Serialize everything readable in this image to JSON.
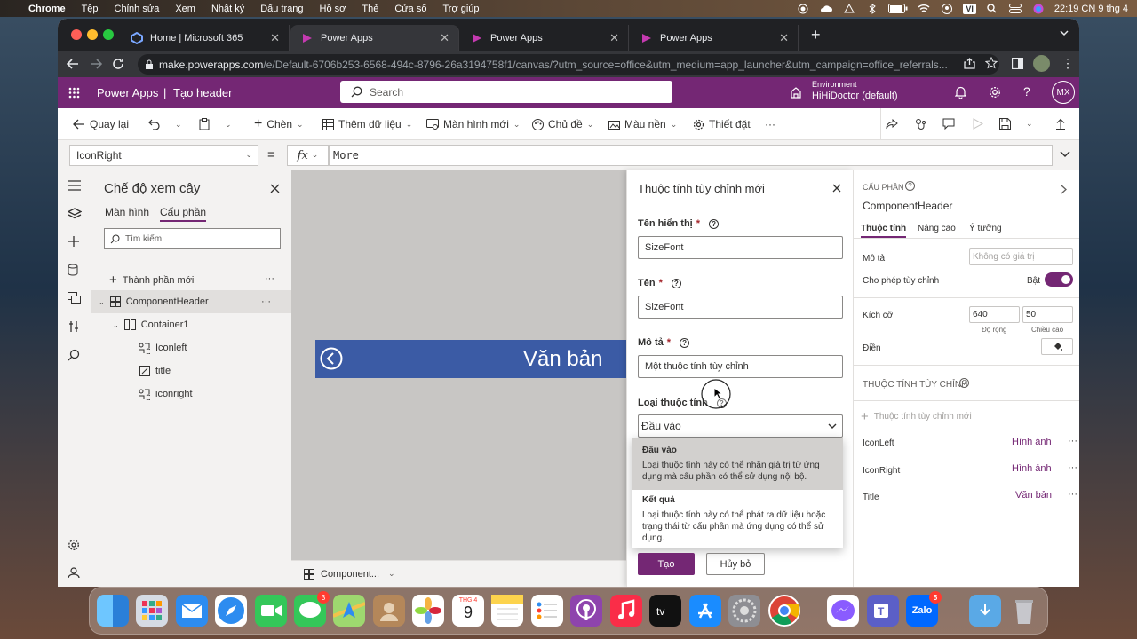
{
  "macmenu": {
    "apple": "",
    "app": "Chrome",
    "items": [
      "Tệp",
      "Chỉnh sửa",
      "Xem",
      "Nhật ký",
      "Dấu trang",
      "Hồ sơ",
      "Thẻ",
      "Cửa sổ",
      "Trợ giúp"
    ],
    "lang": "VI",
    "clock": "22:19 CN 9 thg 4"
  },
  "browser": {
    "tabs": [
      {
        "title": "Home | Microsoft 365"
      },
      {
        "title": "Power Apps"
      },
      {
        "title": "Power Apps"
      },
      {
        "title": "Power Apps"
      }
    ],
    "new_tab": "+",
    "url_host": "make.powerapps.com",
    "url_path": "/e/Default-6706b253-6568-494c-8796-26a3194758f1/canvas/?utm_source=office&utm_medium=app_launcher&utm_campaign=office_referrals..."
  },
  "header": {
    "app": "Power Apps",
    "sep": "|",
    "page": "Tạo header",
    "search_placeholder": "Search",
    "env_label": "Environment",
    "env_name": "HiHiDoctor (default)",
    "avatar": "MX"
  },
  "cmdbar": {
    "back": "Quay lại",
    "insert": "Chèn",
    "add_data": "Thêm dữ liệu",
    "new_screen": "Màn hình mới",
    "theme": "Chủ đề",
    "background": "Màu nền",
    "settings": "Thiết đặt",
    "more": "···"
  },
  "formula": {
    "property": "IconRight",
    "equals": "=",
    "fx": "fx",
    "value": "More"
  },
  "tree": {
    "title": "Chế độ xem cây",
    "tab_screens": "Màn hình",
    "tab_components": "Cấu phần",
    "search_placeholder": "Tìm kiếm",
    "new_component": "Thành phần mới",
    "items": [
      {
        "label": "ComponentHeader"
      },
      {
        "label": "Container1"
      },
      {
        "label": "Iconleft"
      },
      {
        "label": "title"
      },
      {
        "label": "iconright"
      }
    ]
  },
  "canvas": {
    "banner_text": "Văn bản",
    "status_component": "Component..."
  },
  "dialog": {
    "title": "Thuộc tính tùy chỉnh mới",
    "display_name_label": "Tên hiển thị",
    "display_name_value": "SizeFont",
    "name_label": "Tên",
    "name_value": "SizeFont",
    "desc_label": "Mô tả",
    "desc_value": "Một thuộc tính tùy chỉnh",
    "type_label": "Loại thuộc tính",
    "type_value": "Đầu vào",
    "options": [
      {
        "title": "Đầu vào",
        "desc": "Loại thuộc tính này có thể nhận giá trị từ ứng dụng mà cấu phần có thể sử dụng nội bộ."
      },
      {
        "title": "Kết quả",
        "desc": "Loại thuộc tính này có thể phát ra dữ liệu hoặc trạng thái từ cấu phần mà ứng dụng có thể sử dụng."
      }
    ],
    "create": "Tạo",
    "cancel": "Hủy bỏ",
    "required": "*",
    "help": "?"
  },
  "props": {
    "section": "CẤU PHẦN",
    "name": "ComponentHeader",
    "tabs": [
      "Thuộc tính",
      "Nâng cao",
      "Ý tưởng"
    ],
    "desc_label": "Mô tả",
    "desc_placeholder": "Không có giá trị",
    "custom_label": "Cho phép tùy chỉnh",
    "custom_state": "Bật",
    "size_label": "Kích cỡ",
    "width": "640",
    "height": "50",
    "width_label": "Độ rộng",
    "height_label": "Chiều cao",
    "fill_label": "Điền",
    "custom_props_header": "THUỘC TÍNH TÙY CHỈNH",
    "new_custom_prop": "Thuộc tính tùy chỉnh mới",
    "custom_props": [
      {
        "name": "IconLeft",
        "type": "Hình ảnh"
      },
      {
        "name": "IconRight",
        "type": "Hình ảnh"
      },
      {
        "name": "Title",
        "type": "Văn bản"
      }
    ]
  },
  "dock": {
    "calendar_month": "THG 4",
    "calendar_day": "9",
    "messages_badge": "3",
    "zalo_label": "Zalo",
    "zalo_badge": "5"
  },
  "colors": {
    "brand": "#742774",
    "banner": "#3b5ba5",
    "toggle": "#742774"
  }
}
